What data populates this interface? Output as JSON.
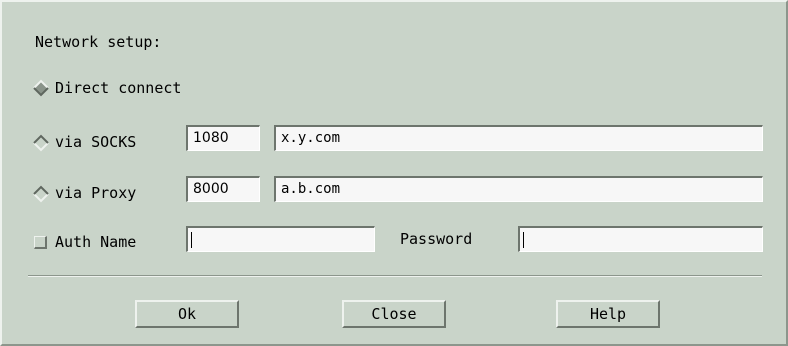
{
  "dialog": {
    "heading": "Network setup:"
  },
  "options": {
    "direct": {
      "label": "Direct connect",
      "selected": true
    },
    "socks": {
      "label": "via SOCKS",
      "selected": false,
      "port": "1080",
      "host": "x.y.com"
    },
    "proxy": {
      "label": "via Proxy",
      "selected": false,
      "port": "8000",
      "host": "a.b.com"
    },
    "auth": {
      "label": "Auth Name",
      "checked": false,
      "name_value": "",
      "password_label": "Password",
      "password_value": ""
    }
  },
  "buttons": {
    "ok": "Ok",
    "close": "Close",
    "help": "Help"
  },
  "icons": {
    "radio_selected": "diamond-radio-selected-icon",
    "radio_unselected": "diamond-radio-unselected-icon",
    "checkbox": "square-checkbox-icon"
  },
  "colors": {
    "background": "#c9d4c9",
    "highlight": "#eef2ee",
    "shadow": "#6d756d",
    "field": "#f7f7f7"
  }
}
